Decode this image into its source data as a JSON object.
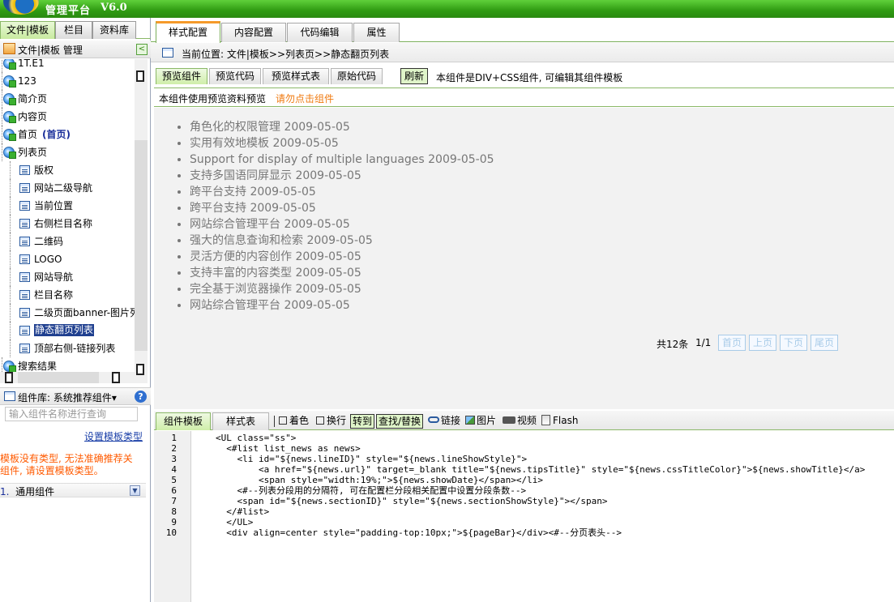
{
  "app": {
    "title": "管理平台",
    "version": "V6.0"
  },
  "left_panel": {
    "tabs": [
      {
        "label": "文件|模板",
        "active": true
      },
      {
        "label": "栏目",
        "active": false
      },
      {
        "label": "资料库",
        "active": false
      }
    ],
    "tree_title": "文件|模板 管理",
    "tree_items": [
      {
        "label": "1T.E1",
        "level": 0,
        "icon": "globe-page-icon"
      },
      {
        "label": "123",
        "level": 0,
        "icon": "globe-page-icon"
      },
      {
        "label": "简介页",
        "level": 0,
        "icon": "globe-page-icon"
      },
      {
        "label": "内容页",
        "level": 0,
        "icon": "globe-page-icon"
      },
      {
        "label": "首页",
        "suffix": "(首页)",
        "level": 0,
        "icon": "globe-page-icon"
      },
      {
        "label": "列表页",
        "level": 0,
        "icon": "globe-page-icon"
      },
      {
        "label": "版权",
        "level": 1,
        "icon": "component-icon"
      },
      {
        "label": "网站二级导航",
        "level": 1,
        "icon": "component-icon"
      },
      {
        "label": "当前位置",
        "level": 1,
        "icon": "component-icon"
      },
      {
        "label": "右侧栏目名称",
        "level": 1,
        "icon": "component-icon"
      },
      {
        "label": "二维码",
        "level": 1,
        "icon": "component-icon"
      },
      {
        "label": "LOGO",
        "level": 1,
        "icon": "component-icon"
      },
      {
        "label": "网站导航",
        "level": 1,
        "icon": "component-icon"
      },
      {
        "label": "栏目名称",
        "level": 1,
        "icon": "component-icon"
      },
      {
        "label": "二级页面banner-图片列",
        "level": 1,
        "icon": "component-icon"
      },
      {
        "label": "静态翻页列表",
        "level": 1,
        "icon": "component-icon",
        "selected": true
      },
      {
        "label": "顶部右侧-链接列表",
        "level": 1,
        "icon": "component-icon"
      },
      {
        "label": "搜索结果",
        "level": 0,
        "icon": "globe-page-icon"
      }
    ],
    "component_library": {
      "title": "组件库: 系统推荐组件▾",
      "search_placeholder": "输入组件名称进行查询",
      "set_type_link": "设置模板类型",
      "warning_line1": "模板没有类型, 无法准确推荐关",
      "warning_line2": "组件, 请设置模板类型。",
      "group_number": "1.",
      "group_label": "通用组件"
    }
  },
  "main": {
    "tabs": [
      {
        "label": "样式配置",
        "active": true
      },
      {
        "label": "内容配置",
        "active": false
      },
      {
        "label": "代码编辑",
        "active": false
      },
      {
        "label": "属性",
        "active": false
      }
    ],
    "breadcrumb": "当前位置: 文件|模板>>列表页>>静态翻页列表",
    "preview_tabs": [
      {
        "label": "预览组件",
        "active": true
      },
      {
        "label": "预览代码",
        "active": false
      },
      {
        "label": "预览样式表",
        "active": false
      },
      {
        "label": "原始代码",
        "active": false
      }
    ],
    "refresh_label": "刷新",
    "component_desc": "本组件是DIV+CSS组件, 可编辑其组件模板",
    "preview_info": "本组件使用预览资料预览",
    "preview_warning": "请勿点击组件",
    "news_items": [
      "角色化的权限管理 2009-05-05",
      "实用有效地模板 2009-05-05",
      "Support for display of multiple languages 2009-05-05",
      "支持多国语同屏显示 2009-05-05",
      "跨平台支持 2009-05-05",
      "跨平台支持 2009-05-05",
      "网站综合管理平台 2009-05-05",
      "强大的信息查询和检索 2009-05-05",
      "灵活方便的内容创作 2009-05-05",
      "支持丰富的内容类型 2009-05-05",
      "完全基于浏览器操作 2009-05-05",
      "网站综合管理平台 2009-05-05"
    ],
    "pager": {
      "total": "共12条",
      "page": "1/1",
      "first": "首页",
      "prev": "上页",
      "next": "下页",
      "last": "尾页"
    }
  },
  "editor": {
    "tabs": [
      {
        "label": "组件模板",
        "active": true
      },
      {
        "label": "样式表",
        "active": false
      }
    ],
    "toolbar": {
      "color": "着色",
      "wrap": "换行",
      "goto": "转到",
      "find_replace": "查找/替换",
      "link": "链接",
      "image": "图片",
      "video": "视频",
      "flash": "Flash"
    },
    "line_numbers": [
      "1",
      "2",
      "3",
      "4",
      "5",
      "6",
      "7",
      "8",
      "9",
      "10"
    ],
    "code_lines": [
      "<UL class=\"ss\">",
      "  <#list list_news as news>",
      "    <li id=\"${news.lineID}\" style=\"${news.lineShowStyle}\">",
      "        <a href=\"${news.url}\" target=_blank title=\"${news.tipsTitle}\" style=\"${news.cssTitleColor}\">${news.showTitle}</a>",
      "        <span style=\"width:19%;\">${news.showDate}</span></li>",
      "    <#--列表分段用的分隔符, 可在配置栏分段相关配置中设置分段条数-->",
      "    <span id=\"${news.sectionID}\" style=\"${news.sectionShowStyle}\"></span>",
      "  </#list>",
      "  </UL>",
      "  <div align=center style=\"padding-top:10px;\">${pageBar}</div><#--分页表头-->"
    ]
  }
}
